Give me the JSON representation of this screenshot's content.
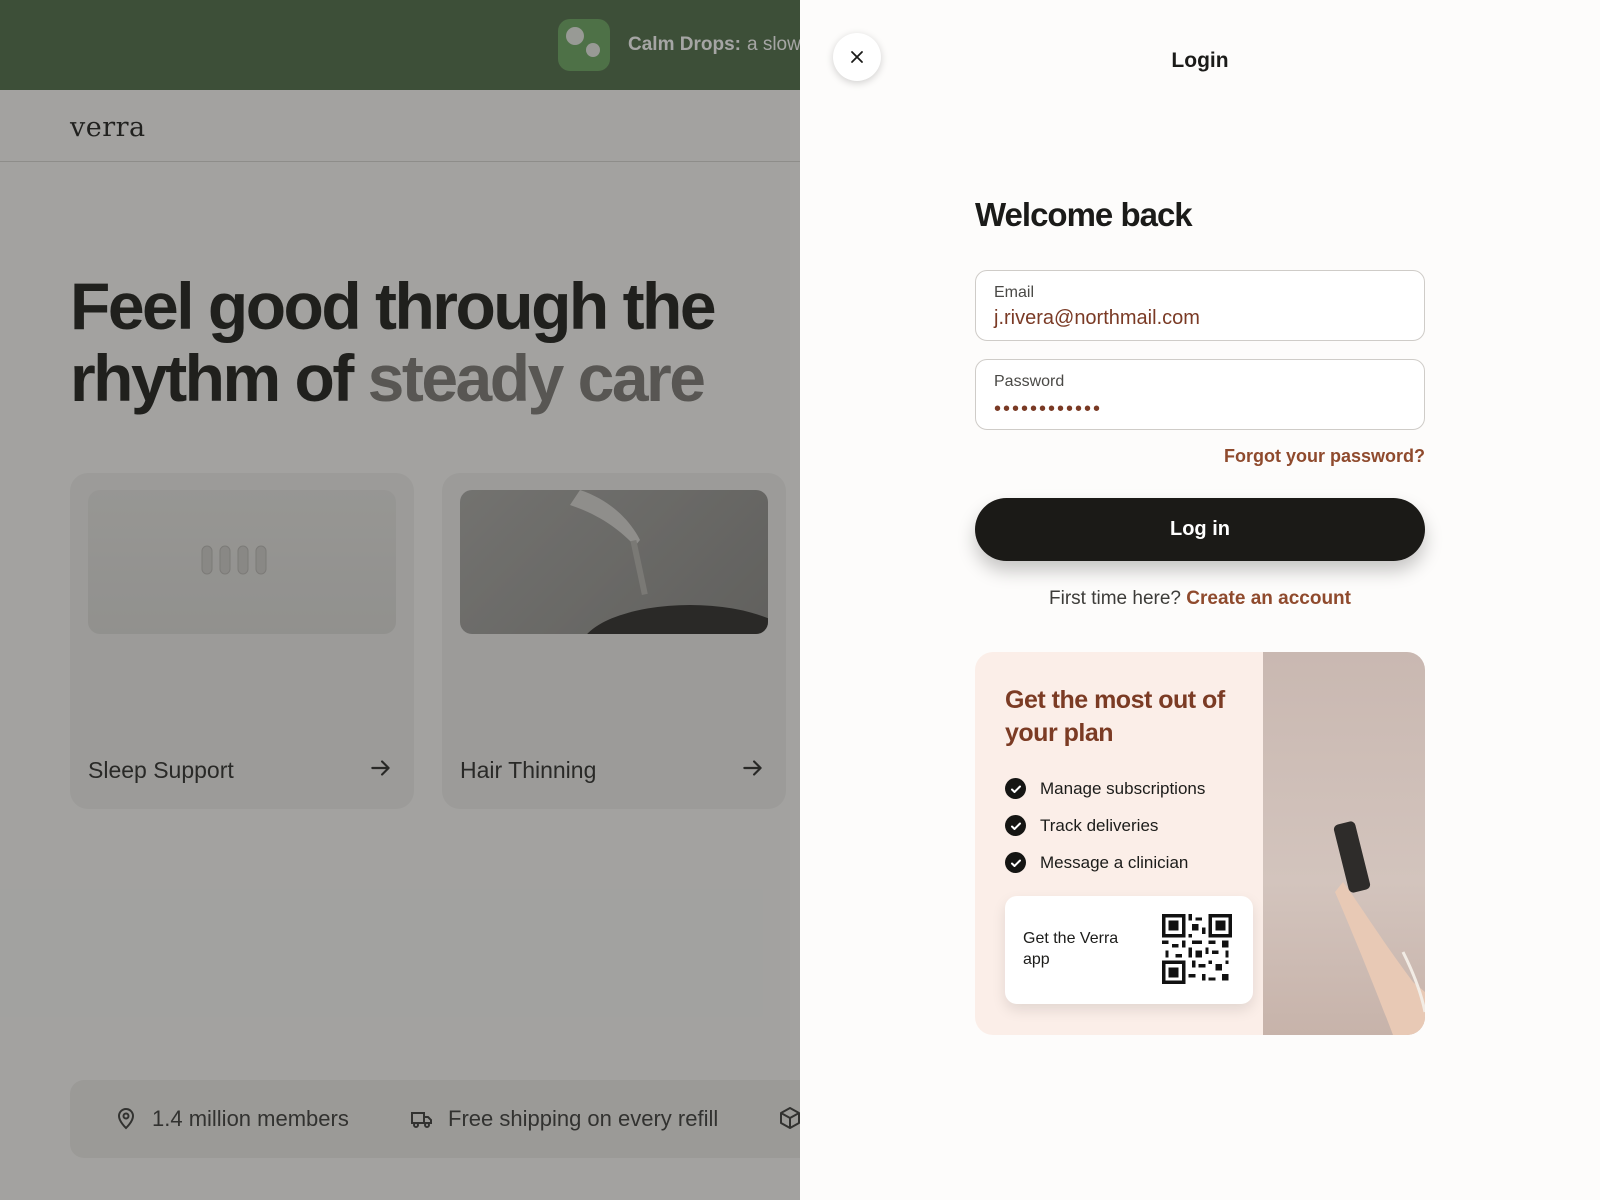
{
  "announcement": {
    "product": "Calm Drops:",
    "text": "a slowe"
  },
  "site": {
    "logo": "verra",
    "hero_line1": "Feel good through the",
    "hero_line2_a": "rhythm of ",
    "hero_line2_b": "steady care"
  },
  "cards": [
    {
      "label": "Sleep Support"
    },
    {
      "label": "Hair Thinning"
    }
  ],
  "trust_bar": [
    {
      "icon": "location-pin-icon",
      "text": "1.4 million members"
    },
    {
      "icon": "truck-icon",
      "text": "Free shipping on every refill"
    },
    {
      "icon": "box-icon",
      "text": ""
    }
  ],
  "login": {
    "title": "Login",
    "heading": "Welcome back",
    "email_label": "Email",
    "email_value": "j.rivera@northmail.com",
    "password_label": "Password",
    "password_value": "••••••••••••",
    "forgot": "Forgot your password?",
    "submit": "Log in",
    "signup_prompt": "First time here?",
    "signup_link": "Create an account"
  },
  "promo": {
    "title": "Get the most out of your plan",
    "features": [
      "Manage subscriptions",
      "Track deliveries",
      "Message a clinician"
    ],
    "app_cta": "Get the Verra app"
  },
  "colors": {
    "announcement_bg": "#4c6b45",
    "accent_link": "#8f4a2d",
    "button_bg": "#1b1a17",
    "promo_bg": "#fbeee8"
  }
}
